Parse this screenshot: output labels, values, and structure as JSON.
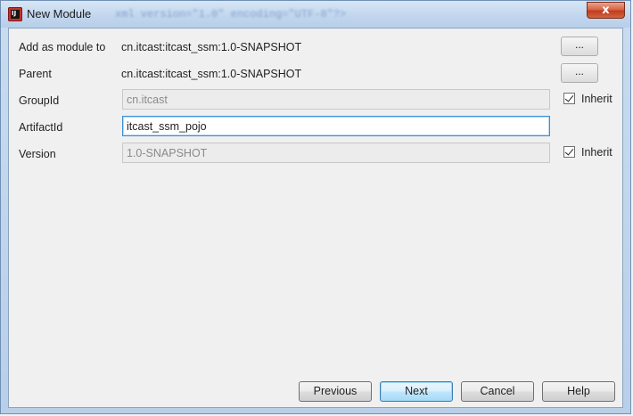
{
  "window": {
    "title": "New Module",
    "background_title_text": "xml version=\"1.0\" encoding=\"UTF-8\"?>",
    "close_symbol": "x",
    "icon": "intellij-app-icon"
  },
  "form": {
    "add_as_module": {
      "label": "Add as module to",
      "value": "cn.itcast:itcast_ssm:1.0-SNAPSHOT",
      "browse_label": "..."
    },
    "parent": {
      "label": "Parent",
      "value": "cn.itcast:itcast_ssm:1.0-SNAPSHOT",
      "browse_label": "..."
    },
    "group_id": {
      "label": "GroupId",
      "value": "cn.itcast",
      "inherit_label": "Inherit",
      "inherit_checked": true
    },
    "artifact_id": {
      "label": "ArtifactId",
      "value": "itcast_ssm_pojo"
    },
    "version": {
      "label": "Version",
      "value": "1.0-SNAPSHOT",
      "inherit_label": "Inherit",
      "inherit_checked": true
    }
  },
  "footer": {
    "previous_label": "Previous",
    "next_label": "Next",
    "cancel_label": "Cancel",
    "help_label": "Help"
  },
  "colors": {
    "title_bar": "#c2d6ee",
    "close_button": "#c23c1d",
    "focused_border": "#3c8fd8",
    "default_button": "#bee6fd"
  }
}
